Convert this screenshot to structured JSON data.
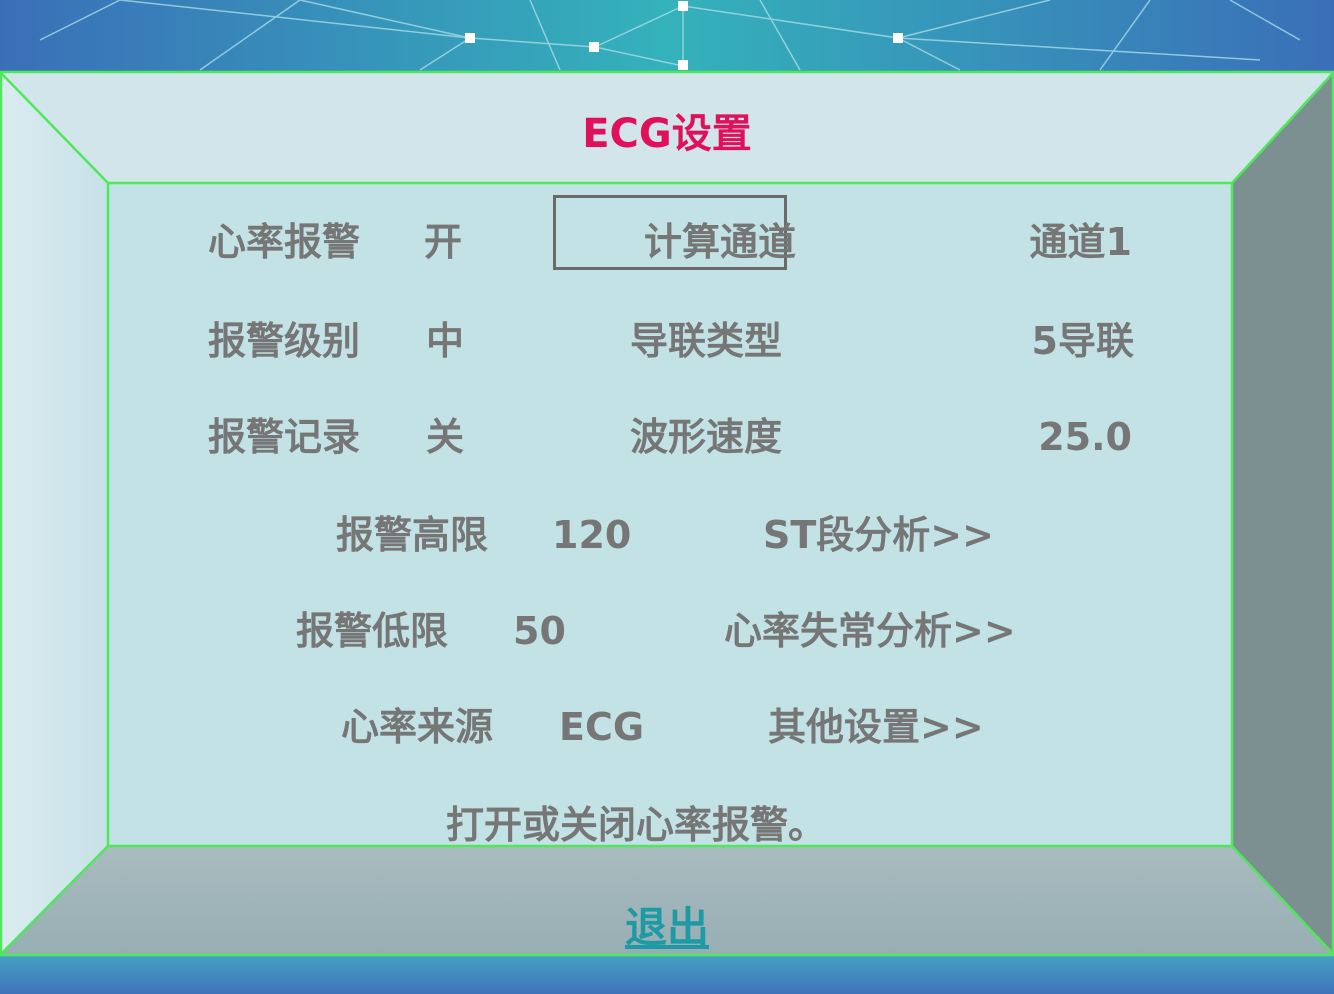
{
  "window": {
    "title": "ECG设置"
  },
  "settings": {
    "hr_alarm": {
      "label": "心率报警",
      "value": "开"
    },
    "alarm_level": {
      "label": "报警级别",
      "value": "中"
    },
    "alarm_record": {
      "label": "报警记录",
      "value": "关"
    },
    "calc_channel": {
      "label": "计算通道",
      "value": "通道1"
    },
    "lead_type": {
      "label": "导联类型",
      "value": "5导联"
    },
    "sweep_speed": {
      "label": "波形速度",
      "value": "25.0"
    },
    "alarm_high": {
      "label": "报警高限",
      "value": "120"
    },
    "alarm_low": {
      "label": "报警低限",
      "value": "50"
    },
    "hr_source": {
      "label": "心率来源",
      "value": "ECG"
    }
  },
  "submenus": {
    "st_analysis": "ST段分析>>",
    "arrhythmia": "心率失常分析>>",
    "other": "其他设置>>"
  },
  "help_text": "打开或关闭心率报警。",
  "exit_label": "退出",
  "colors": {
    "title": "#e0105a",
    "label": "#767676",
    "exit_link": "#1e9aa4",
    "frame_edge": "#4ee85a",
    "panel": "#c2e2e6"
  }
}
